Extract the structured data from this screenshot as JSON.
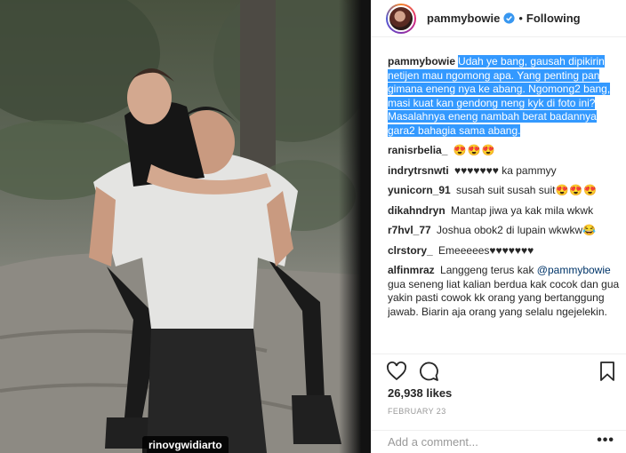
{
  "post": {
    "photo_tag": "rinovgwidiarto"
  },
  "header": {
    "username": "pammybowie",
    "separator": "•",
    "follow_status": "Following"
  },
  "caption": {
    "username": "pammybowie",
    "text": "Udah ye bang, gausah dipikirin netijen mau ngomong apa. Yang penting pan gimana eneng nya ke abang. Ngomong2 bang, masi kuat kan gendong neng kyk di foto ini? Masalahnya eneng nambah berat badannya gara2 bahagia sama abang."
  },
  "comments": [
    {
      "username": "ranisrbelia_",
      "text": "",
      "emoji": "😍😍😍"
    },
    {
      "username": "indrytrsnwti",
      "text": "ka pammyy",
      "hearts": "♥♥♥♥♥♥♥"
    },
    {
      "username": "yunicorn_91",
      "text": "susah suit susah suit",
      "emoji": "😍😍😍"
    },
    {
      "username": "dikahndryn",
      "text": "Mantap jiwa ya kak mila wkwk"
    },
    {
      "username": "r7hvl_77",
      "text": "Joshua obok2 di lupain wkwkw",
      "emoji": "😂"
    },
    {
      "username": "clrstory_",
      "text": "Emeeeees",
      "hearts": "♥♥♥♥♥♥♥"
    },
    {
      "username": "alfinmraz",
      "text": "Langgeng terus kak",
      "mention": "@pammybowie",
      "text2": "gua seneng liat kalian berdua kak cocok dan gua yakin pasti cowok kk orang yang bertanggung jawab. Biarin aja orang yang selalu ngejelekin."
    }
  ],
  "engagement": {
    "likes": "26,938 likes",
    "date": "FEBRUARY 23"
  },
  "comment_box": {
    "placeholder": "Add a comment...",
    "more": "•••"
  },
  "icons": [
    "verified-badge-icon",
    "heart-icon",
    "comment-icon",
    "bookmark-icon",
    "more-options-icon"
  ],
  "colors": {
    "accent_blue": "#3897f0",
    "selection_blue": "#3399ff",
    "text": "#262626",
    "muted": "#999999"
  }
}
